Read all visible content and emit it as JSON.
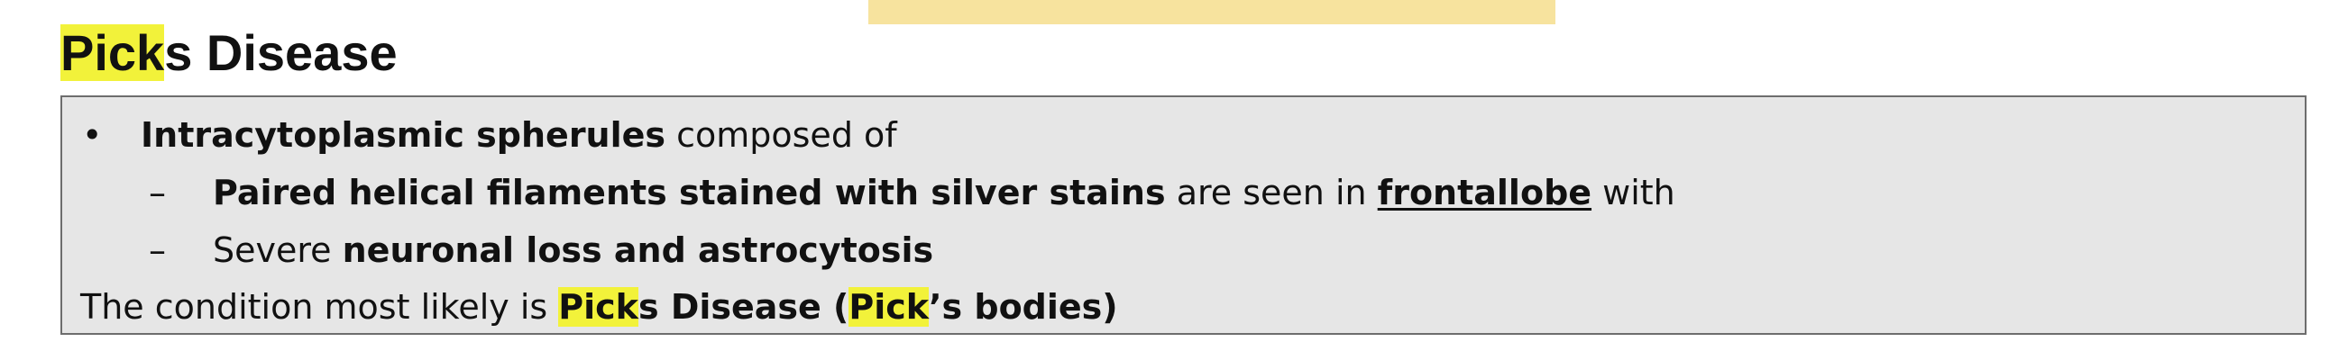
{
  "top_highlight_color": "#f7e39e",
  "highlight_color": "#f2f23a",
  "heading": {
    "hl": "Pick",
    "rest": "s Disease"
  },
  "box": {
    "bullet_glyph": "•",
    "dash_glyph": "–",
    "line1": {
      "bold": "Intracytoplasmic spherules",
      "rest": " composed of"
    },
    "line2": {
      "bold": "Paired helical filaments stained with silver stains",
      "mid": " are seen in ",
      "underlined": "frontallobe",
      "end": " with"
    },
    "line3": {
      "plain": "Severe ",
      "bold": "neuronal loss and astrocytosis"
    },
    "line4": {
      "plain": "The condition most likely is ",
      "hl1": "Pick",
      "bold1": "s Disease (",
      "hl2": "Pick",
      "bold2": "’s bodies)"
    }
  }
}
